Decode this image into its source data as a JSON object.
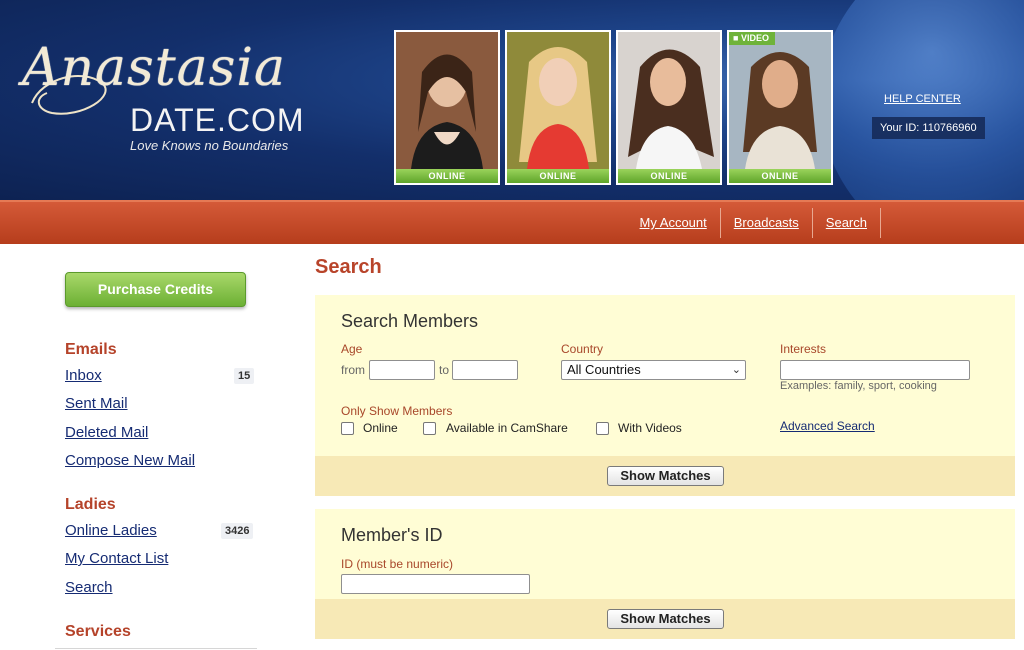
{
  "header": {
    "logo_script": "Anastasia",
    "logo_main": "DATE.COM",
    "tagline": "Love Knows no Boundaries",
    "photo_status": "ONLINE",
    "video_badge": "VIDEO",
    "help_center": "HELP CENTER",
    "your_id": "Your ID: 110766960"
  },
  "nav": {
    "items": [
      "My Account",
      "Broadcasts",
      "Search"
    ]
  },
  "sidebar": {
    "purchase_label": "Purchase Credits",
    "emails_heading": "Emails",
    "inbox": "Inbox",
    "inbox_count": "15",
    "sent_mail": "Sent Mail",
    "deleted_mail": "Deleted Mail",
    "compose": "Compose New Mail",
    "ladies_heading": "Ladies",
    "online_ladies": "Online Ladies",
    "online_count": "3426",
    "contact_list": "My Contact List",
    "search": "Search",
    "services_heading": "Services"
  },
  "main": {
    "page_title": "Search",
    "search_members": {
      "title": "Search Members",
      "age_label": "Age",
      "from_label": "from",
      "to_label": "to",
      "age_from": "",
      "age_to": "",
      "country_label": "Country",
      "country_value": "All Countries",
      "interests_label": "Interests",
      "interests_value": "",
      "interests_hint": "Examples: family, sport, cooking",
      "only_show_label": "Only Show Members",
      "opt_online": "Online",
      "opt_camshare": "Available in CamShare",
      "opt_videos": "With Videos",
      "advanced_search": "Advanced Search",
      "show_matches": "Show Matches"
    },
    "member_id": {
      "title": "Member's ID",
      "id_label": "ID (must be numeric)",
      "id_value": "",
      "show_matches": "Show Matches"
    }
  },
  "colors": {
    "nav_red": "#c24a28",
    "header_blue": "#1f468c",
    "accent_green": "#6cb034",
    "heading_red": "#b5432a",
    "link_blue": "#152b73",
    "panel_bg": "#fffdd5",
    "panel_footer": "#f7e9b6"
  }
}
